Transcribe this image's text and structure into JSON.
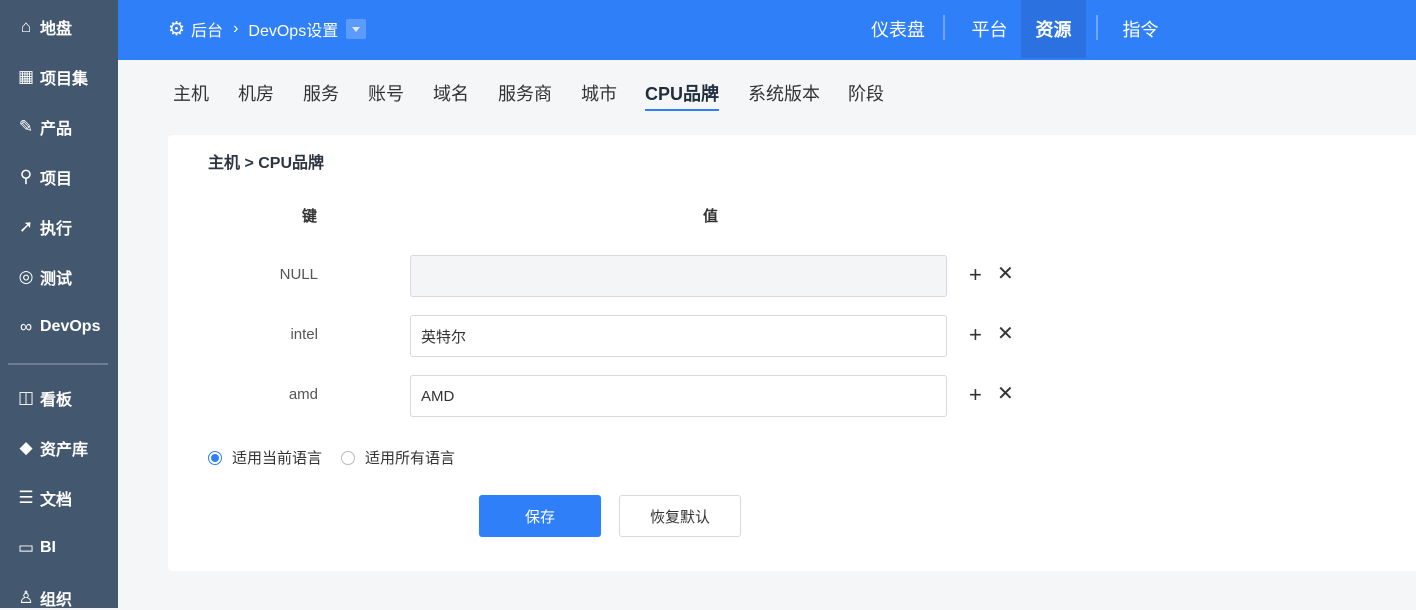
{
  "sidebar": {
    "items": [
      {
        "label": "地盘",
        "icon": "home-icon"
      },
      {
        "label": "项目集",
        "icon": "grid-icon"
      },
      {
        "label": "产品",
        "icon": "bulb-icon"
      },
      {
        "label": "项目",
        "icon": "rocket-icon"
      },
      {
        "label": "执行",
        "icon": "run-icon"
      },
      {
        "label": "测试",
        "icon": "search-icon"
      },
      {
        "label": "DevOps",
        "icon": "infinity-icon"
      },
      {
        "label": "看板",
        "icon": "kanban-icon"
      },
      {
        "label": "资产库",
        "icon": "diamond-icon"
      },
      {
        "label": "文档",
        "icon": "doc-icon"
      },
      {
        "label": "BI",
        "icon": "monitor-icon"
      },
      {
        "label": "组织",
        "icon": "users-icon"
      }
    ]
  },
  "topbar": {
    "breadcrumb": {
      "root": "后台",
      "current": "DevOps设置"
    },
    "nav": [
      {
        "label": "仪表盘"
      },
      {
        "label": "平台"
      },
      {
        "label": "资源",
        "active": true
      },
      {
        "label": "指令"
      }
    ]
  },
  "tabs": [
    "主机",
    "机房",
    "服务",
    "账号",
    "域名",
    "服务商",
    "城市",
    "CPU品牌",
    "系统版本",
    "阶段"
  ],
  "active_tab": "CPU品牌",
  "form": {
    "title": "主机 > CPU品牌",
    "key_header": "键",
    "value_header": "值",
    "rows": [
      {
        "key": "NULL",
        "value": ""
      },
      {
        "key": "intel",
        "value": "英特尔"
      },
      {
        "key": "amd",
        "value": "AMD"
      }
    ],
    "radio_current": "适用当前语言",
    "radio_all": "适用所有语言",
    "save": "保存",
    "reset": "恢复默认"
  },
  "colors": {
    "primary": "#2f7ff8",
    "sidebar": "#43576e"
  }
}
